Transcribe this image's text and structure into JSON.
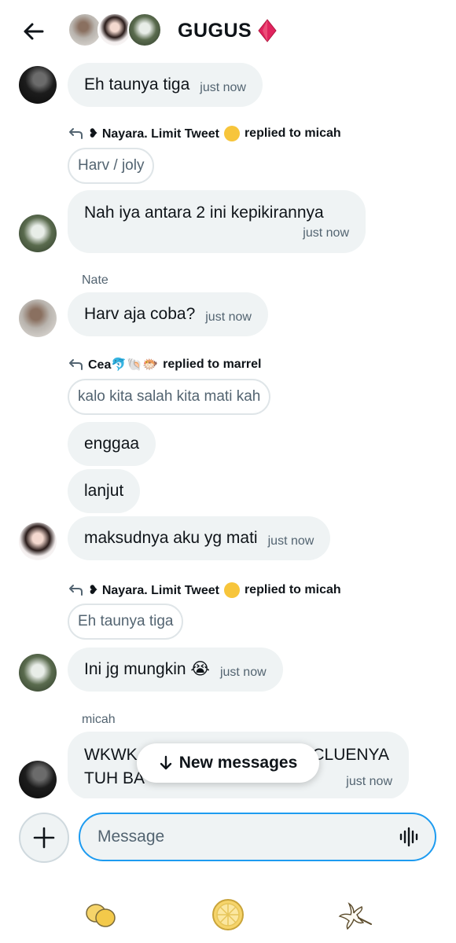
{
  "header": {
    "title": "GUGUS",
    "back_icon": "arrow-left-icon",
    "title_emoji": "red-diamond-icon"
  },
  "messages": [
    {
      "type": "inline",
      "text": "Eh taunya tiga",
      "time": "just now"
    },
    {
      "reply_name": "❥ Nayara. Limit Tweet",
      "reply_suffix": "replied to micah",
      "quote": "Harv / joly"
    },
    {
      "text": "Nah iya antara 2 ini kepikirannya",
      "time": "just now"
    },
    {
      "sender": "Nate",
      "text": "Harv aja coba?",
      "time": "just now"
    },
    {
      "reply_name": "Cea🐬🐚🐡",
      "reply_suffix": "replied to marrel",
      "quote": "kalo kita salah kita mati kah"
    },
    {
      "text": "enggaa"
    },
    {
      "text": "lanjut"
    },
    {
      "text": "maksudnya aku yg mati",
      "time": "just now"
    },
    {
      "reply_name": "❥ Nayara. Limit Tweet",
      "reply_suffix": "replied to micah",
      "quote": "Eh taunya tiga"
    },
    {
      "text": "Ini jg mungkin 😭",
      "time": "just now"
    },
    {
      "sender": "micah",
      "text_left": "WKWK",
      "text_right": "CLUENYA",
      "text_line2": "TUH BA",
      "time": "just now"
    }
  ],
  "new_messages_pill": {
    "label": "New messages",
    "icon": "arrow-down-icon"
  },
  "composer": {
    "placeholder": "Message",
    "add_icon": "plus-icon",
    "voice_icon": "voice-wave-icon"
  },
  "bottom_nav": [
    {
      "icon": "lemons-icon"
    },
    {
      "icon": "lemon-slice-icon"
    },
    {
      "icon": "flower-icon"
    }
  ],
  "colors": {
    "accent": "#1d9bf0",
    "bubble": "#eff3f4",
    "muted": "#536471",
    "text": "#0f1419"
  }
}
